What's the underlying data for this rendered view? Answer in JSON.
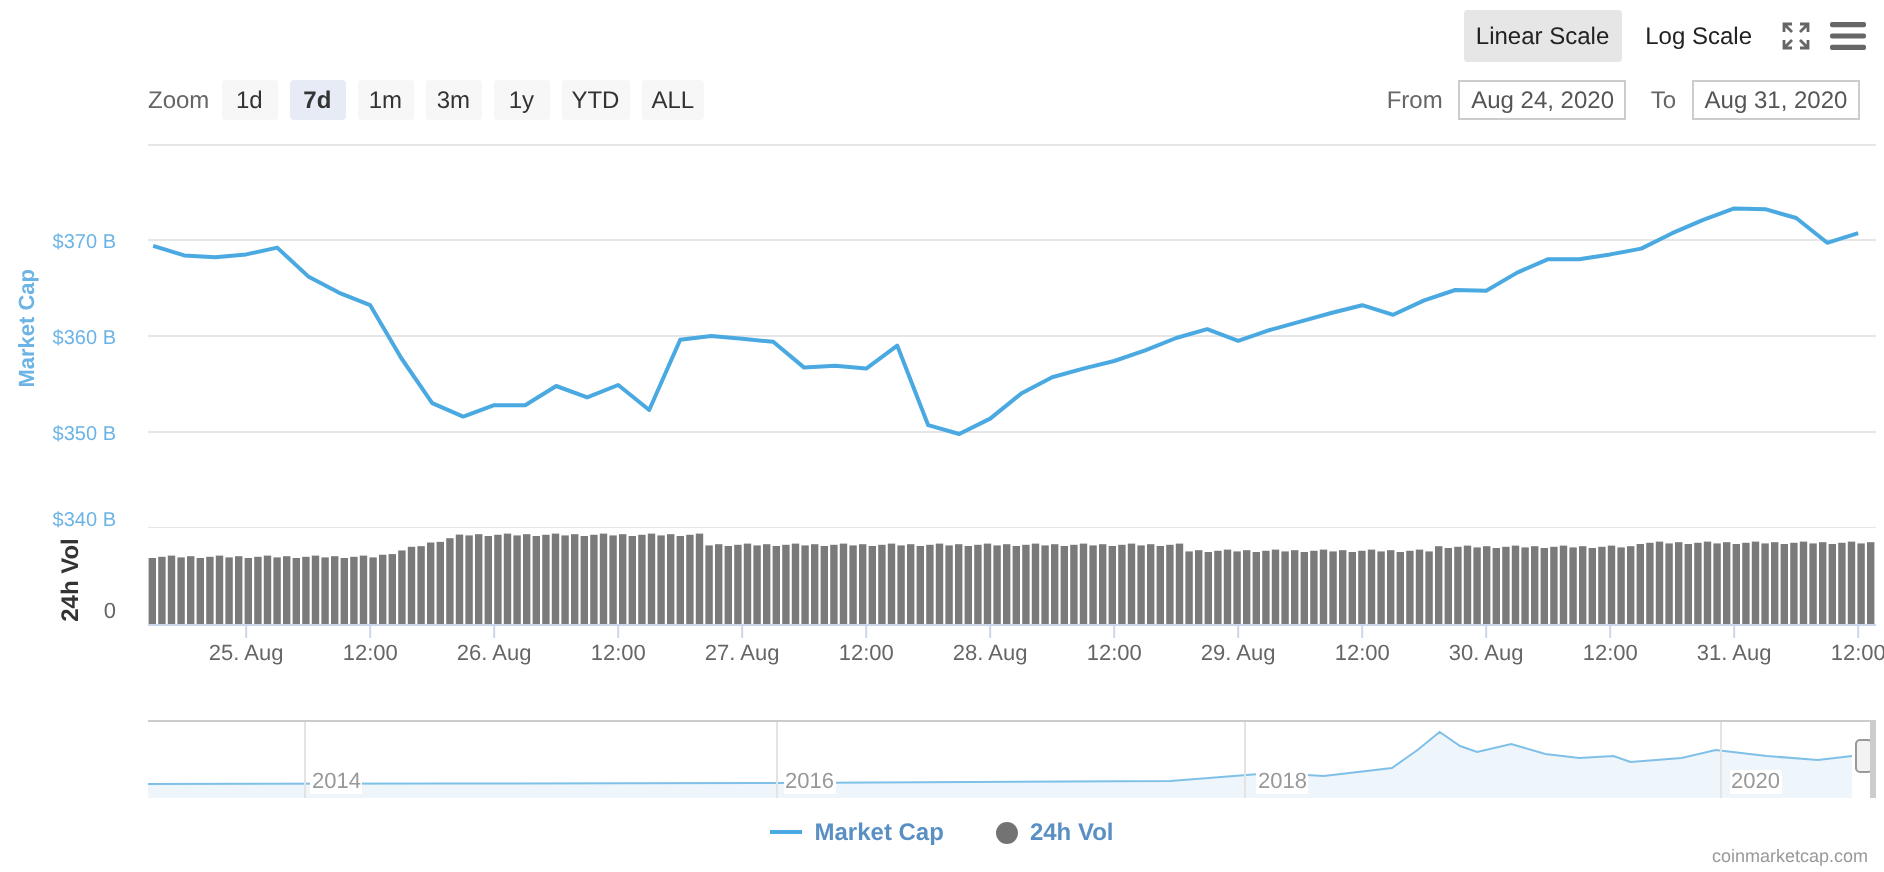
{
  "toolbar": {
    "scale_buttons": [
      {
        "label": "Linear Scale",
        "selected": true
      },
      {
        "label": "Log Scale",
        "selected": false
      }
    ]
  },
  "range_selector": {
    "label": "Zoom",
    "buttons": [
      {
        "label": "1d",
        "selected": false
      },
      {
        "label": "7d",
        "selected": true
      },
      {
        "label": "1m",
        "selected": false
      },
      {
        "label": "3m",
        "selected": false
      },
      {
        "label": "1y",
        "selected": false
      },
      {
        "label": "YTD",
        "selected": false
      },
      {
        "label": "ALL",
        "selected": false
      }
    ],
    "from": {
      "label": "From",
      "value": "Aug 24, 2020"
    },
    "to": {
      "label": "To",
      "value": "Aug 31, 2020"
    }
  },
  "chart": {
    "chart_data": {
      "type": "line",
      "ylabel": "Market Cap",
      "categories": [
        null,
        null,
        null,
        "25. Aug",
        null,
        null,
        null,
        "12:00",
        null,
        null,
        null,
        "26. Aug",
        null,
        null,
        null,
        "12:00",
        null,
        null,
        null,
        "27. Aug",
        null,
        null,
        null,
        "12:00",
        null,
        null,
        null,
        "28. Aug",
        null,
        null,
        null,
        "12:00",
        null,
        null,
        null,
        "29. Aug",
        null,
        null,
        null,
        "12:00",
        null,
        null,
        null,
        "30. Aug",
        null,
        null,
        null,
        "12:00",
        null,
        null,
        null,
        "31. Aug",
        null,
        null,
        null,
        "12:00"
      ],
      "series": [
        {
          "name": "Market Cap",
          "color": "#4aa9e0",
          "values": [
            369.4,
            368.4,
            368.2,
            368.5,
            369.2,
            366.2,
            364.5,
            363.2,
            357.7,
            353.0,
            351.6,
            352.8,
            352.8,
            354.8,
            353.6,
            354.9,
            352.3,
            359.6,
            360.0,
            359.7,
            359.4,
            356.7,
            356.9,
            356.6,
            359.0,
            350.7,
            349.8,
            351.4,
            354.0,
            355.7,
            356.6,
            357.4,
            358.5,
            359.8,
            360.7,
            359.5,
            360.6,
            361.5,
            362.4,
            363.2,
            362.2,
            363.7,
            364.8,
            364.7,
            366.6,
            368.0,
            368.0,
            368.5,
            369.1,
            370.7,
            372.1,
            373.3,
            373.2,
            372.3,
            369.7,
            370.7
          ]
        }
      ],
      "grid": true,
      "ylim": [
        340,
        380
      ],
      "yticks": [
        {
          "value": 340,
          "label": "$340 B"
        },
        {
          "value": 350,
          "label": "$350 B"
        },
        {
          "value": 360,
          "label": "$360 B"
        },
        {
          "value": 370,
          "label": "$370 B"
        }
      ]
    },
    "volume_axis": {
      "title": "24h Vol",
      "tick": "0"
    }
  },
  "navigator": {
    "labels": [
      "2014",
      "2016",
      "2018",
      "2020"
    ]
  },
  "legend": [
    {
      "kind": "line",
      "color": "#4aa9e0"
    },
    {
      "label": "24h Vol",
      "kind": "dot",
      "color": "#737373"
    }
  ],
  "credit": "coinmarketcap.com"
}
